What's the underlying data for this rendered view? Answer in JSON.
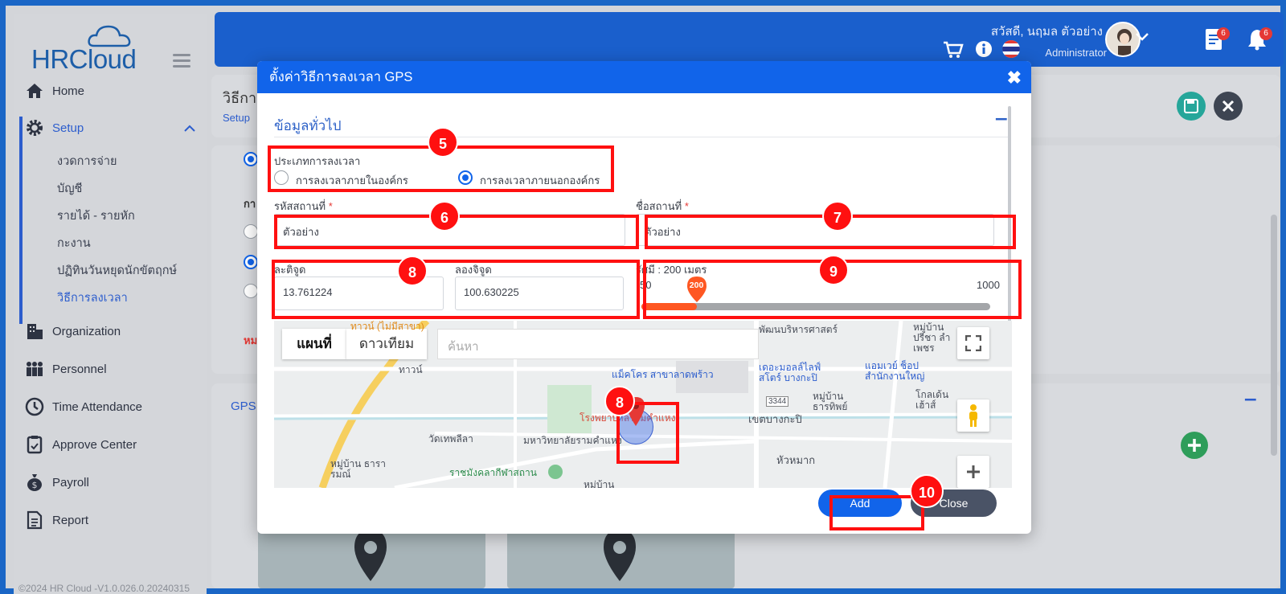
{
  "app": {
    "logo_text": "HRCloud",
    "footer": "©2024 HR Cloud -V1.0.026.0.20240315"
  },
  "sidebar": {
    "items": [
      {
        "label": "Home",
        "icon": "home-icon"
      },
      {
        "label": "Setup",
        "icon": "gear-icon"
      },
      {
        "label": "Organization",
        "icon": "building-icon"
      },
      {
        "label": "Personnel",
        "icon": "people-icon"
      },
      {
        "label": "Time Attendance",
        "icon": "clock-icon"
      },
      {
        "label": "Approve Center",
        "icon": "clipboard-icon"
      },
      {
        "label": "Payroll",
        "icon": "money-bag-icon"
      },
      {
        "label": "Report",
        "icon": "document-icon"
      }
    ],
    "sub_items": [
      "งวดการจ่าย",
      "บัญชี",
      "รายได้ - รายหัก",
      "กะงาน",
      "ปฏิทินวันหยุดนักขัตฤกษ์",
      "วิธีการลงเวลา"
    ]
  },
  "topbar": {
    "greeting": "สวัสดี, นฤมล ตัวอย่าง",
    "role": "Administrator",
    "doc_badge": "6",
    "bell_badge": "6"
  },
  "background": {
    "page_title": "วิธีกา",
    "breadcrumb": "Setup",
    "gps_tab": "GPS",
    "row_prefix_1": "กา",
    "row_prefix_2": "หม"
  },
  "modal": {
    "title": "ตั้งค่าวิธีการลงเวลา GPS",
    "section_title": "ข้อมูลทั่วไป",
    "clock_type_label": "ประเภทการลงเวลา",
    "clock_option_inside": "การลงเวลาภายในองค์กร",
    "clock_option_outside": "การลงเวลาภายนอกองค์กร",
    "location_code_label": "รหัสสถานที่",
    "location_code_value": "ตัวอย่าง",
    "location_name_label": "ชื่อสถานที่",
    "location_name_value": "ตัวอย่าง",
    "latitude_label": "ละติจูด",
    "latitude_value": "13.761224",
    "longitude_label": "ลองจิจูด",
    "longitude_value": "100.630225",
    "radius_label": "รัศมี : 200 เมตร",
    "radius_min": "50",
    "radius_max": "1000",
    "radius_value": "200",
    "radius_fraction": 0.158,
    "required_mark": "*",
    "add_label": "Add",
    "close_label": "Close"
  },
  "map": {
    "tab_map": "แผนที่",
    "tab_satellite": "ดาวเทียม",
    "search_placeholder": "ค้นหา",
    "labels": [
      "ทาวน์ (ไม่มีสาขา)",
      "พัฒนบริหารศาสตร์",
      "หมู่บ้าน ปรีชา ลำเพชร",
      "ทาวน์",
      "แม็คโคร สาขาลาดพร้าว",
      "เดอะมอลล์ไลฟ์ สโตร์ บางกะปิ",
      "แอมเวย์ ช็อป สำนักงานใหญ่",
      "หมู่บ้าน ธารทิพย์",
      "โกลเด้น เฮ้าส์",
      "เขตบางกะปิ",
      "วัดเทพลีลา",
      "มหาวิทยาลัยรามคำแหง",
      "ราชมังคลากีฬาสถาน",
      "หมู่บ้าน ธารารมณ์",
      "หัวหมาก",
      "หมู่บ้าน",
      "โรงพยาบาลรามคำแหง",
      "3344"
    ]
  },
  "annotations": [
    "5",
    "6",
    "7",
    "8",
    "9",
    "8",
    "10"
  ],
  "colors": {
    "primary": "#1164ea",
    "header": "#1a5fcc",
    "annotation": "#ff1010",
    "slider": "#fe5722",
    "close_button": "#4a5366"
  }
}
